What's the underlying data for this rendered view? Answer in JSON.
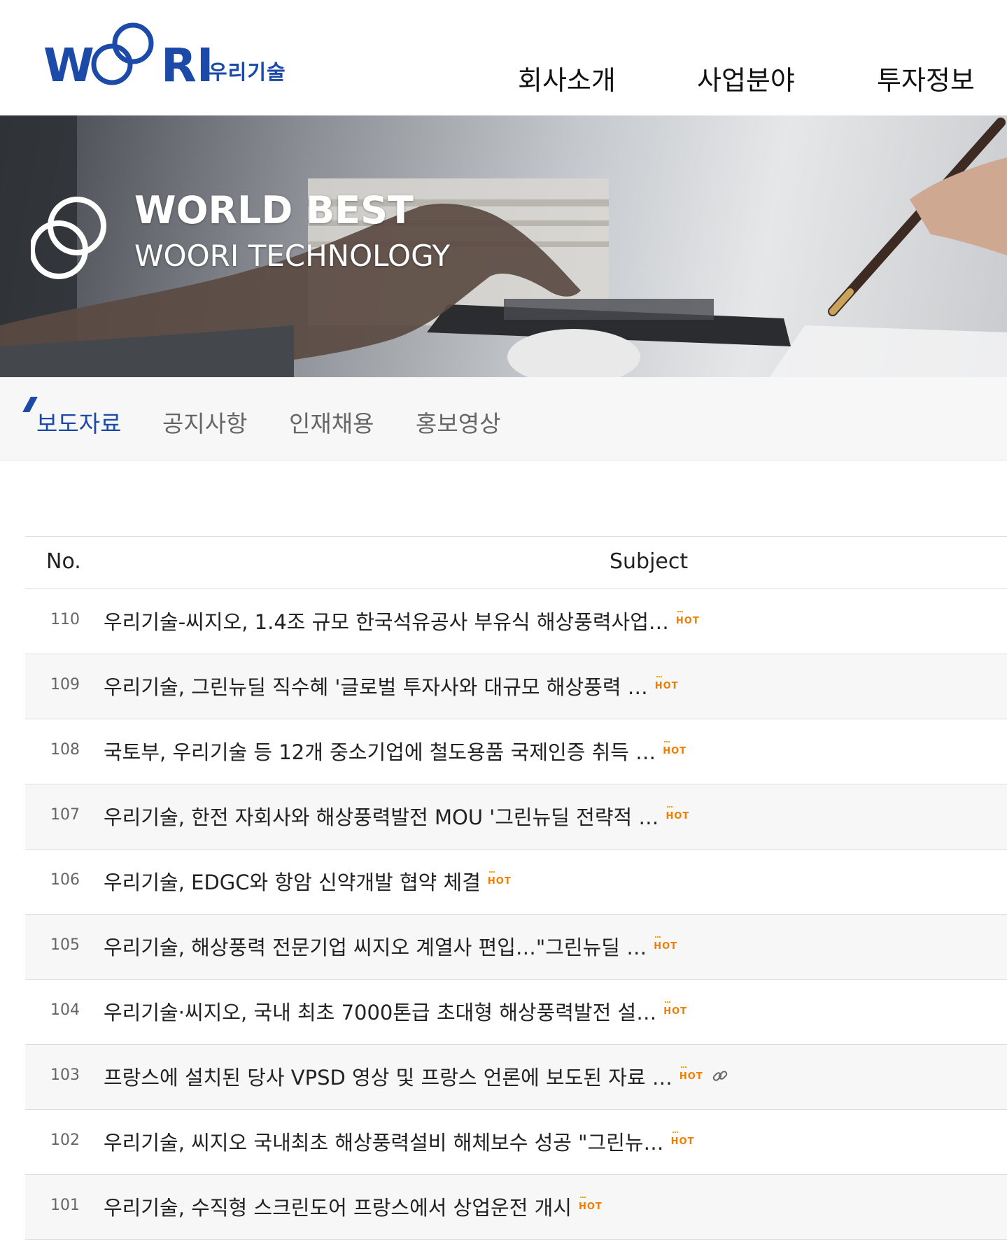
{
  "header": {
    "logo_main": "WOORI",
    "logo_sub": "우리기술",
    "nav": [
      "회사소개",
      "사업분야",
      "투자정보"
    ]
  },
  "hero": {
    "title": "WORLD BEST",
    "subtitle": "WOORI TECHNOLOGY"
  },
  "tabs": [
    "보도자료",
    "공지사항",
    "인재채용",
    "홍보영상"
  ],
  "active_tab": 0,
  "board": {
    "col_no": "No.",
    "col_subject": "Subject",
    "rows": [
      {
        "no": "110",
        "subject": "우리기술-씨지오, 1.4조 규모 한국석유공사 부유식 해상풍력사업…",
        "hot": "HOT"
      },
      {
        "no": "109",
        "subject": "우리기술, 그린뉴딜 직수혜 '글로벌 투자사와 대규모 해상풍력 …",
        "hot": "HOT"
      },
      {
        "no": "108",
        "subject": "국토부, 우리기술 등 12개 중소기업에 철도용품 국제인증 취득 …",
        "hot": "HOT"
      },
      {
        "no": "107",
        "subject": "우리기술, 한전 자회사와 해상풍력발전 MOU '그린뉴딜 전략적 …",
        "hot": "HOT"
      },
      {
        "no": "106",
        "subject": "우리기술, EDGC와 항암 신약개발 협약 체결",
        "hot": "HOT"
      },
      {
        "no": "105",
        "subject": "우리기술, 해상풍력 전문기업 씨지오 계열사 편입…\"그린뉴딜 …",
        "hot": "HOT"
      },
      {
        "no": "104",
        "subject": "우리기술·씨지오, 국내 최초 7000톤급 초대형 해상풍력발전 설…",
        "hot": "HOT"
      },
      {
        "no": "103",
        "subject": "프랑스에 설치된 당사 VPSD 영상 및 프랑스 언론에 보도된 자료 …",
        "hot": "HOT",
        "link_icon": "link-icon"
      },
      {
        "no": "102",
        "subject": "우리기술, 씨지오 국내최초 해상풍력설비 해체보수 성공 \"그린뉴…",
        "hot": "HOT"
      },
      {
        "no": "101",
        "subject": "우리기술, 수직형 스크린도어 프랑스에서 상업운전 개시",
        "hot": "HOT"
      }
    ]
  },
  "colors": {
    "brand_blue": "#1c4aa8",
    "hot_orange": "#f07d00",
    "row_alt": "#f7f7f7"
  }
}
